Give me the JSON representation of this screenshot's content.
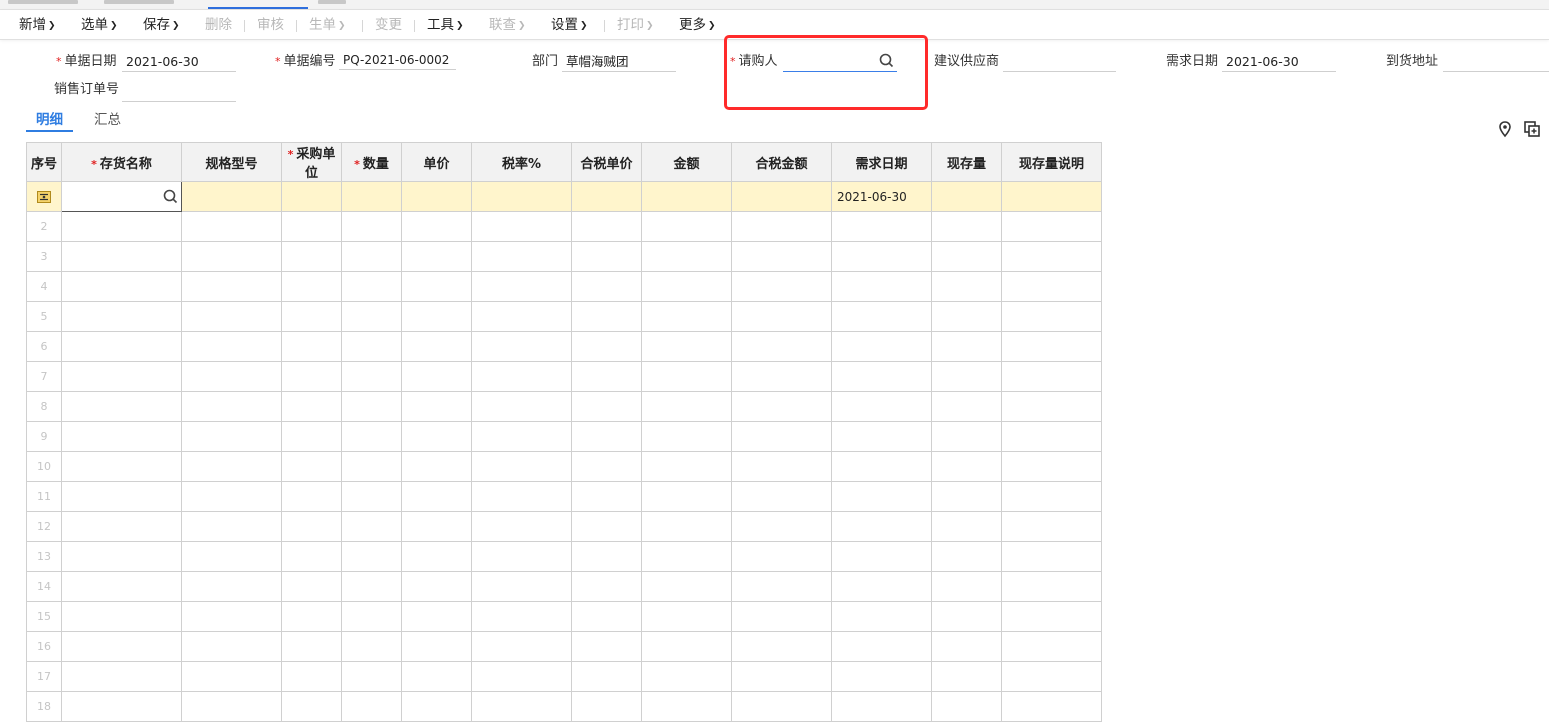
{
  "toolbar": {
    "items": [
      {
        "label": "新增",
        "disabled": false,
        "dropdown": true
      },
      {
        "label": "选单",
        "disabled": false,
        "dropdown": true
      },
      {
        "label": "保存",
        "disabled": false,
        "dropdown": true
      },
      {
        "label": "删除",
        "disabled": true,
        "dropdown": false
      },
      {
        "label": "审核",
        "disabled": true,
        "dropdown": false
      },
      {
        "label": "生单",
        "disabled": true,
        "dropdown": true
      },
      {
        "label": "变更",
        "disabled": true,
        "dropdown": false
      },
      {
        "label": "工具",
        "disabled": false,
        "dropdown": true
      },
      {
        "label": "联查",
        "disabled": true,
        "dropdown": true
      },
      {
        "label": "设置",
        "disabled": false,
        "dropdown": true
      },
      {
        "label": "打印",
        "disabled": true,
        "dropdown": true
      },
      {
        "label": "更多",
        "disabled": false,
        "dropdown": true
      }
    ]
  },
  "header": {
    "doc_date": {
      "label": "单据日期",
      "value": "2021-06-30",
      "required": true
    },
    "doc_no": {
      "label": "单据编号",
      "value": "PQ-2021-06-0002",
      "required": true
    },
    "department": {
      "label": "部门",
      "value": "草帽海贼团",
      "required": false
    },
    "requester": {
      "label": "请购人",
      "value": "",
      "required": true
    },
    "supplier": {
      "label": "建议供应商",
      "value": "",
      "required": false
    },
    "need_date": {
      "label": "需求日期",
      "value": "2021-06-30",
      "required": false
    },
    "address": {
      "label": "到货地址",
      "value": "",
      "required": false
    },
    "sales_order": {
      "label": "销售订单号",
      "value": "",
      "required": false
    }
  },
  "subtabs": [
    {
      "label": "明细",
      "active": true
    },
    {
      "label": "汇总",
      "active": false
    }
  ],
  "grid": {
    "columns": [
      {
        "label": "序号",
        "required": false
      },
      {
        "label": "存货名称",
        "required": true
      },
      {
        "label": "规格型号",
        "required": false
      },
      {
        "label": "采购单位",
        "required": true
      },
      {
        "label": "数量",
        "required": true
      },
      {
        "label": "单价",
        "required": false
      },
      {
        "label": "税率%",
        "required": false
      },
      {
        "label": "合税单价",
        "required": false
      },
      {
        "label": "金额",
        "required": false
      },
      {
        "label": "合税金额",
        "required": false
      },
      {
        "label": "需求日期",
        "required": false
      },
      {
        "label": "现存量",
        "required": false
      },
      {
        "label": "现存量说明",
        "required": false
      }
    ],
    "first_row_date": "2021-06-30",
    "row_numbers": [
      "2",
      "3",
      "4",
      "5",
      "6",
      "7",
      "8",
      "9",
      "10",
      "11",
      "12",
      "13",
      "14",
      "15",
      "16",
      "17",
      "18"
    ]
  },
  "colors": {
    "accent": "#2f7de1",
    "required": "#e02020",
    "highlight": "#ff2a2a",
    "editing_row": "#fff5cc"
  },
  "icons": {
    "search": "search-icon",
    "location": "location-pin-icon",
    "copy": "copy-add-icon",
    "row_edit": "row-edit-icon"
  }
}
